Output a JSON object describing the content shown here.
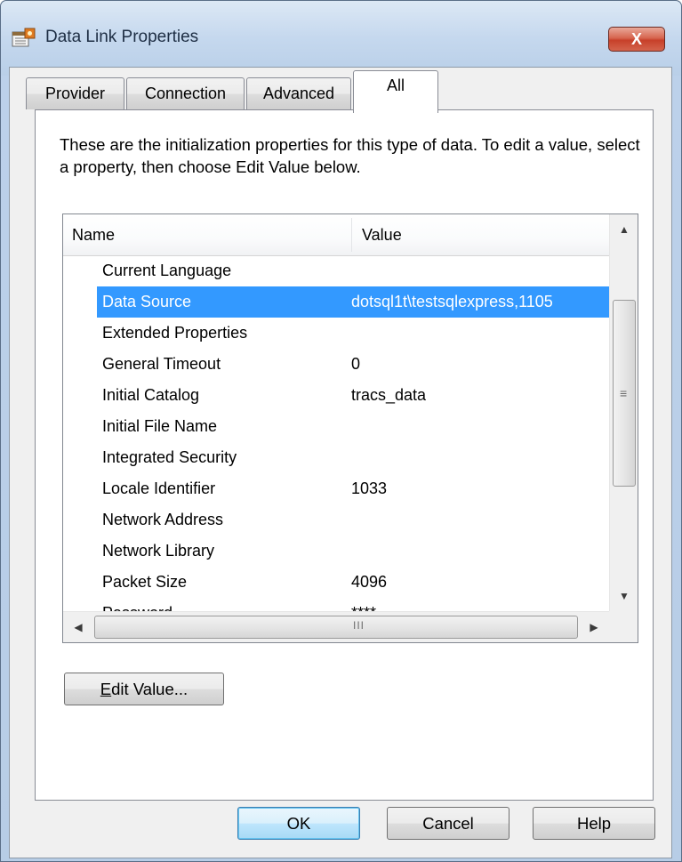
{
  "window": {
    "title": "Data Link Properties",
    "close_label": "X"
  },
  "tabs": [
    {
      "label": "Provider",
      "active": false
    },
    {
      "label": "Connection",
      "active": false
    },
    {
      "label": "Advanced",
      "active": false
    },
    {
      "label": "All",
      "active": true
    }
  ],
  "description": "These are the initialization properties for this type of data. To edit a value, select a property, then choose Edit Value below.",
  "property_list": {
    "columns": [
      "Name",
      "Value"
    ],
    "rows": [
      {
        "name": "Current Language",
        "value": ""
      },
      {
        "name": "Data Source",
        "value": "dotsql1t\\testsqlexpress,1105",
        "selected": true
      },
      {
        "name": "Extended Properties",
        "value": ""
      },
      {
        "name": "General Timeout",
        "value": "0"
      },
      {
        "name": "Initial Catalog",
        "value": "tracs_data"
      },
      {
        "name": "Initial File Name",
        "value": ""
      },
      {
        "name": "Integrated Security",
        "value": ""
      },
      {
        "name": "Locale Identifier",
        "value": "1033"
      },
      {
        "name": "Network Address",
        "value": ""
      },
      {
        "name": "Network Library",
        "value": ""
      },
      {
        "name": "Packet Size",
        "value": "4096"
      },
      {
        "name": "Password",
        "value": "****"
      }
    ],
    "vscroll_grip": "≡",
    "hscroll_grip": "III"
  },
  "buttons": {
    "edit_value_mnemonic": "E",
    "edit_value_rest": "dit Value...",
    "ok": "OK",
    "cancel": "Cancel",
    "help": "Help"
  },
  "colors": {
    "selection": "#3399ff",
    "close_button": "#c7402a"
  }
}
